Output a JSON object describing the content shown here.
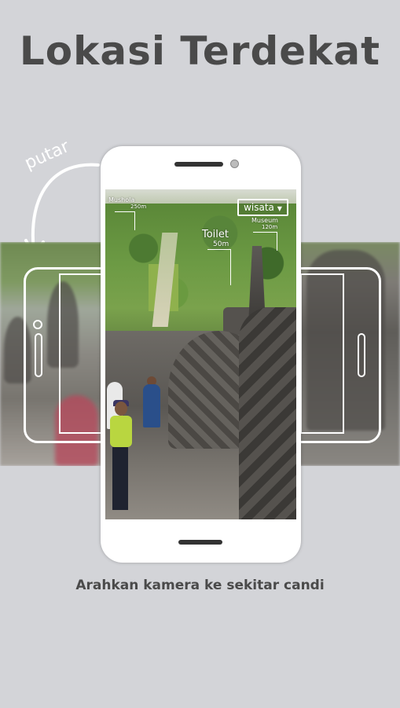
{
  "page": {
    "title": "Lokasi Terdekat",
    "hint": "putar",
    "caption": "Arahkan kamera ke sekitar candi"
  },
  "ar": {
    "filter": {
      "label": "wisata",
      "icon": "caret-down-icon"
    },
    "markers": [
      {
        "name": "Mushola",
        "distance": "250m"
      },
      {
        "name": "Toilet",
        "distance": "50m"
      },
      {
        "name": "Museum",
        "distance": "120m"
      }
    ]
  },
  "colors": {
    "background": "#d3d4d8",
    "title_text": "#4a4a4a",
    "outline": "#ffffff"
  }
}
